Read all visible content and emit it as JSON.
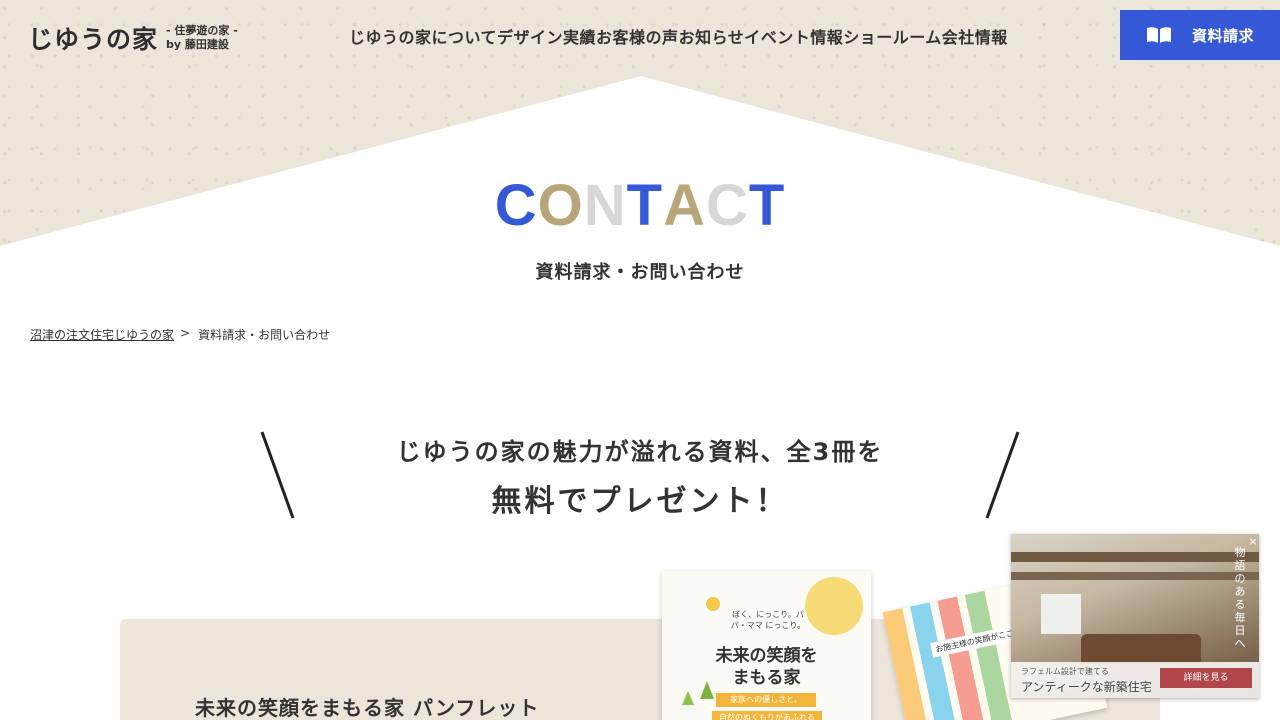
{
  "header": {
    "logo_main": "じゆうの家",
    "logo_sub_line1": "- 住夢遊の家 -",
    "logo_sub_line2": "by 藤田建設",
    "nav": [
      {
        "label": "じゆうの家について"
      },
      {
        "label": "デザイン実績"
      },
      {
        "label": "お客様の声"
      },
      {
        "label": "お知らせ"
      },
      {
        "label": "イベント情報"
      },
      {
        "label": "ショールーム"
      },
      {
        "label": "会社情報"
      }
    ],
    "request_button": "資料請求",
    "request_icon": "book-icon",
    "accent_color": "#3558d6"
  },
  "hero": {
    "title_letters": [
      {
        "ch": "C",
        "color": "#3558d6"
      },
      {
        "ch": "O",
        "color": "#b9a57a"
      },
      {
        "ch": "N",
        "color": "#d7d7d7"
      },
      {
        "ch": "T",
        "color": "#3558d6"
      },
      {
        "ch": "A",
        "color": "#b9a57a"
      },
      {
        "ch": "C",
        "color": "#d7d7d7"
      },
      {
        "ch": "T",
        "color": "#3558d6"
      }
    ],
    "subtitle": "資料請求・お問い合わせ"
  },
  "breadcrumb": {
    "home": "沼津の注文住宅じゆうの家",
    "separator": ">",
    "current": "資料請求・お問い合わせ"
  },
  "promo": {
    "line1": "じゆうの家の魅力が溢れる資料、全3冊を",
    "line2": "無料でプレゼント！"
  },
  "card": {
    "title": "未来の笑顔をまもる家 パンフレット",
    "book1": {
      "small_text": "ぼく、にっこり。パパ・ママ にっこり。",
      "main_line1": "未来の笑顔を",
      "main_line2": "まもる家",
      "tag1": "家族への優しさと、",
      "tag2": "自然のぬくもりがあふれる"
    },
    "book2": {
      "heading": "お施主様の笑顔がここに"
    }
  },
  "popup": {
    "vertical_text": "物語のある毎日へ",
    "line1": "ラフェルム設計で建てる",
    "line2": "アンティークな新築住宅",
    "more_button": "詳細を見る",
    "close": "×"
  }
}
